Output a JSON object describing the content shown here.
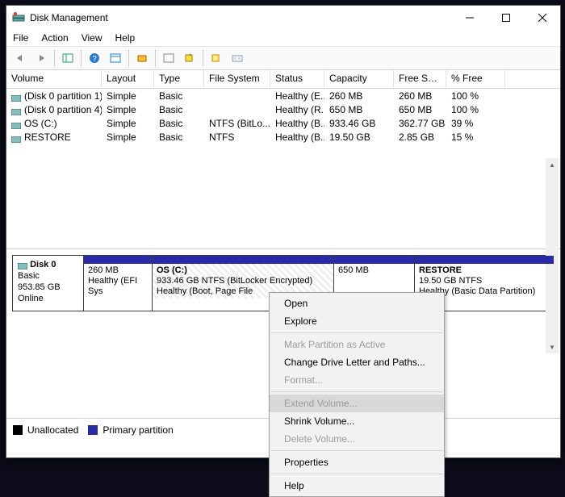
{
  "title": "Disk Management",
  "menus": [
    "File",
    "Action",
    "View",
    "Help"
  ],
  "columns": [
    "Volume",
    "Layout",
    "Type",
    "File System",
    "Status",
    "Capacity",
    "Free Spa...",
    "% Free"
  ],
  "volumes": [
    {
      "name": "(Disk 0 partition 1)",
      "layout": "Simple",
      "type": "Basic",
      "fs": "",
      "status": "Healthy (E...",
      "cap": "260 MB",
      "free": "260 MB",
      "pct": "100 %"
    },
    {
      "name": "(Disk 0 partition 4)",
      "layout": "Simple",
      "type": "Basic",
      "fs": "",
      "status": "Healthy (R...",
      "cap": "650 MB",
      "free": "650 MB",
      "pct": "100 %"
    },
    {
      "name": "OS (C:)",
      "layout": "Simple",
      "type": "Basic",
      "fs": "NTFS (BitLo...",
      "status": "Healthy (B...",
      "cap": "933.46 GB",
      "free": "362.77 GB",
      "pct": "39 %"
    },
    {
      "name": "RESTORE",
      "layout": "Simple",
      "type": "Basic",
      "fs": "NTFS",
      "status": "Healthy (B...",
      "cap": "19.50 GB",
      "free": "2.85 GB",
      "pct": "15 %"
    }
  ],
  "disk": {
    "name": "Disk 0",
    "type": "Basic",
    "size": "953.85 GB",
    "state": "Online",
    "parts": [
      {
        "title": "",
        "l1": "260 MB",
        "l2": "Healthy (EFI Sys"
      },
      {
        "title": "OS  (C:)",
        "l1": "933.46 GB NTFS (BitLocker Encrypted)",
        "l2": "Healthy (Boot, Page File"
      },
      {
        "title": "",
        "l1": "650 MB",
        "l2": ""
      },
      {
        "title": "RESTORE",
        "l1": "19.50 GB NTFS",
        "l2": "Healthy (Basic Data Partition)"
      }
    ]
  },
  "legend": {
    "unalloc": "Unallocated",
    "primary": "Primary partition"
  },
  "ctx": {
    "open": "Open",
    "explore": "Explore",
    "mark": "Mark Partition as Active",
    "letter": "Change Drive Letter and Paths...",
    "format": "Format...",
    "extend": "Extend Volume...",
    "shrink": "Shrink Volume...",
    "delete": "Delete Volume...",
    "props": "Properties",
    "help": "Help"
  }
}
